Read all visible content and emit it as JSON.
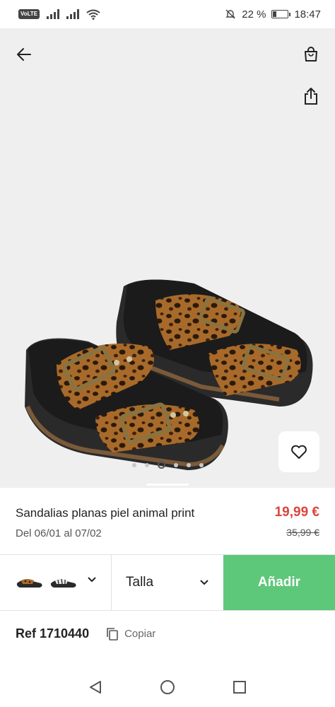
{
  "status_bar": {
    "volte": "VoLTE",
    "battery_percent": "22 %",
    "time": "18:47"
  },
  "product": {
    "title": "Sandalias planas piel animal print",
    "delivery": "Del 06/01 al 07/02",
    "price": "19,99 €",
    "old_price": "35,99 €",
    "image_count": 8,
    "active_image_index": 3
  },
  "actions": {
    "size_label": "Talla",
    "add_label": "Añadir"
  },
  "ref": {
    "label": "Ref 1710440",
    "copy_label": "Copiar"
  },
  "colors": {
    "accent_green": "#5dc77a",
    "price_red": "#d9453f"
  },
  "icons": [
    "back-arrow-icon",
    "shopping-bag-icon",
    "share-icon",
    "heart-icon",
    "chevron-down-icon",
    "copy-icon",
    "nav-back-icon",
    "nav-home-icon",
    "nav-recents-icon"
  ]
}
